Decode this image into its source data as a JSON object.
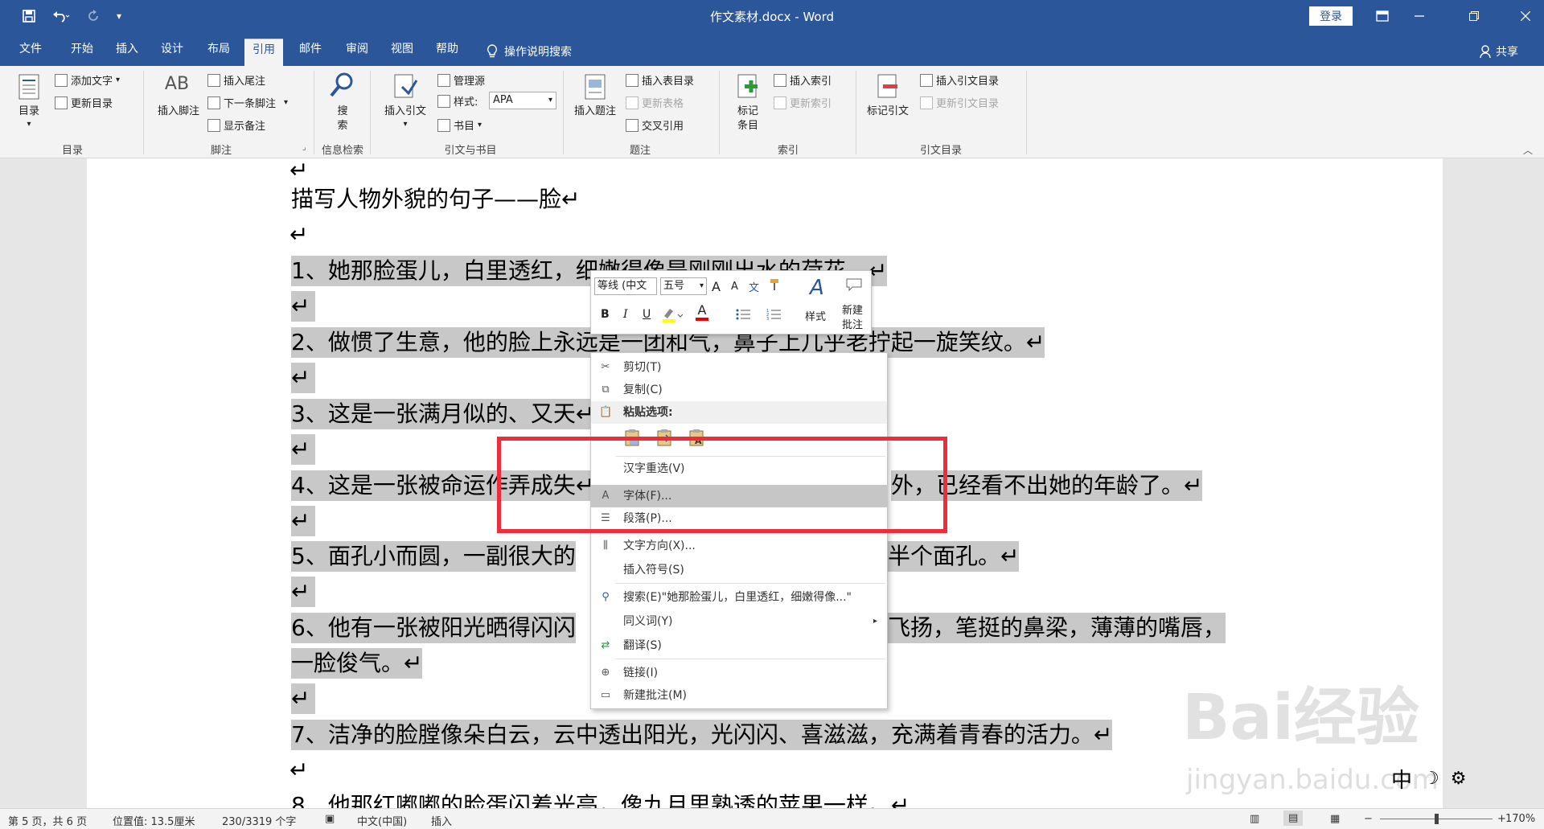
{
  "titlebar": {
    "title": "作文素材.docx  -  Word",
    "login": "登录",
    "save_icon": "save-icon",
    "undo_icon": "undo-icon",
    "redo_icon": "redo-icon"
  },
  "tabs": [
    {
      "label": "文件"
    },
    {
      "label": "开始"
    },
    {
      "label": "插入"
    },
    {
      "label": "设计"
    },
    {
      "label": "布局"
    },
    {
      "label": "引用"
    },
    {
      "label": "邮件"
    },
    {
      "label": "审阅"
    },
    {
      "label": "视图"
    },
    {
      "label": "帮助"
    }
  ],
  "tellme": "操作说明搜索",
  "share": "共享",
  "ribbon": {
    "toc": {
      "label": "目录",
      "add_text": "添加文字",
      "update": "更新目录",
      "group": "目录"
    },
    "footnote": {
      "insert": "插入脚注",
      "insert_endnote": "插入尾注",
      "next": "下一条脚注",
      "show": "显示备注",
      "group": "脚注",
      "big_glyph": "AB"
    },
    "research": {
      "label1": "搜",
      "label2": "索",
      "group": "信息检索"
    },
    "citation": {
      "insert": "插入引文",
      "manage": "管理源",
      "style_label": "样式:",
      "style_value": "APA",
      "biblio": "书目",
      "group": "引文与书目"
    },
    "caption": {
      "insert": "插入题注",
      "insert_table": "插入表目录",
      "update_table": "更新表格",
      "cross_ref": "交叉引用",
      "group": "题注"
    },
    "index": {
      "mark1": "标记",
      "mark2": "条目",
      "insert": "插入索引",
      "update": "更新索引",
      "group": "索引"
    },
    "toa": {
      "mark": "标记引文",
      "insert": "插入引文目录",
      "update": "更新引文目录",
      "group": "引文目录"
    }
  },
  "document": {
    "lines": [
      {
        "text": "描写人物外貌的句子——脸↵",
        "sel": false
      },
      {
        "text": "1、她那脸蛋儿，白里透红，细嫩得像是刚刚出水的荷花。↵",
        "sel": true
      },
      {
        "text": "2、做惯了生意，他的脸上永远是一团和气，鼻子上几乎老拧起一旋笑纹。↵",
        "sel": true
      },
      {
        "text": "3、这是一张满月似的、又天↵",
        "sel": true
      },
      {
        "text": "4、这是一张被命运作弄成失↵",
        "sel": true
      },
      {
        "text": "外，已经看不出她的年龄了。↵",
        "sel": true
      },
      {
        "text": "5、面孔小而圆，一副很大的",
        "sel": true
      },
      {
        "text": "半个面孔。↵",
        "sel": true
      },
      {
        "text": "6、他有一张被阳光晒得闪闪",
        "sel": true
      },
      {
        "text": "飞扬，笔挺的鼻梁，薄薄的嘴唇，",
        "sel": true
      },
      {
        "text": "一脸俊气。↵",
        "sel": true
      },
      {
        "text": "7、洁净的脸膛像朵白云，云中透出阳光，光闪闪、喜滋滋，充满着青春的活力。↵",
        "sel": true
      },
      {
        "text": "8、他那红嘟嘟的脸蛋闪着光亮，像九月里熟透的苹果一样。↵",
        "sel": false
      }
    ],
    "para_mark": "↵"
  },
  "minitoolbar": {
    "font": "等线 (中文",
    "size": "五号",
    "grow": "A",
    "shrink": "A",
    "phonetic": "文",
    "bold": "B",
    "italic": "I",
    "underline": "U",
    "fontcolor": "A",
    "styles": "样式",
    "new_comment1": "新建",
    "new_comment2": "批注"
  },
  "contextmenu": {
    "items": [
      {
        "label": "剪切(T)",
        "icon": "scissors-icon"
      },
      {
        "label": "复制(C)",
        "icon": "copy-icon"
      },
      {
        "label": "粘贴选项:",
        "icon": "paste-icon"
      },
      {
        "label": "汉字重选(V)",
        "icon": ""
      },
      {
        "label": "字体(F)...",
        "icon": "font-icon"
      },
      {
        "label": "段落(P)...",
        "icon": "paragraph-icon"
      },
      {
        "label": "文字方向(X)...",
        "icon": "text-direction-icon"
      },
      {
        "label": "插入符号(S)",
        "icon": ""
      },
      {
        "label": "搜索(E)\"她那脸蛋儿，白里透红，细嫩得像...\"",
        "icon": "search-icon"
      },
      {
        "label": "同义词(Y)",
        "icon": ""
      },
      {
        "label": "翻译(S)",
        "icon": "translate-icon"
      },
      {
        "label": "链接(I)",
        "icon": "link-icon"
      },
      {
        "label": "新建批注(M)",
        "icon": "comment-icon"
      }
    ]
  },
  "watermark": {
    "brand": "Bai经验",
    "site": "jingyan.baidu.com"
  },
  "ime": {
    "mode": "中"
  },
  "status": {
    "page": "第 5 页，共 6 页",
    "position": "位置值: 13.5厘米",
    "words": "230/3319 个字",
    "language": "中文(中国)",
    "mode": "插入",
    "zoom": "170%"
  },
  "colors": {
    "accent": "#2b579a",
    "highlight_box": "#ee2d3a",
    "selection": "#c8c8c8"
  }
}
